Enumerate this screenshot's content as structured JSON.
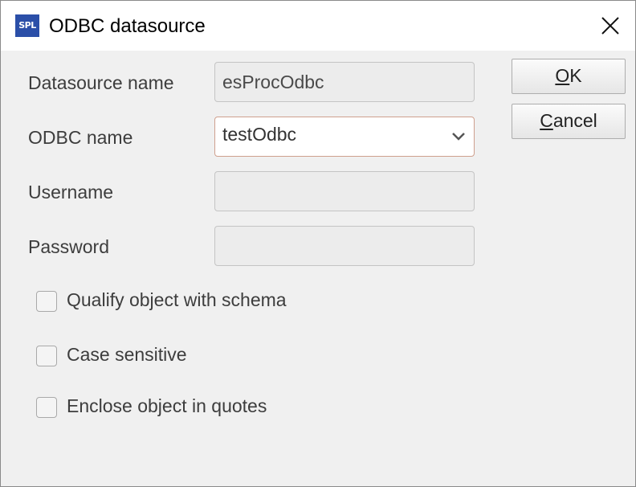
{
  "window": {
    "icon_text": "SPL",
    "title": "ODBC datasource",
    "close_icon": "close-icon"
  },
  "form": {
    "datasource_name": {
      "label": "Datasource name",
      "value": "esProcOdbc"
    },
    "odbc_name": {
      "label": "ODBC name",
      "value": "testOdbc",
      "icon": "chevron-down-icon"
    },
    "username": {
      "label": "Username",
      "value": ""
    },
    "password": {
      "label": "Password",
      "value": ""
    }
  },
  "options": {
    "qualify": {
      "label": "Qualify object with schema",
      "checked": false
    },
    "case_sensitive": {
      "label": "Case sensitive",
      "checked": false
    },
    "enclose": {
      "label": "Enclose object in quotes",
      "checked": false
    }
  },
  "buttons": {
    "ok": {
      "mnemonic": "O",
      "rest": "K"
    },
    "cancel": {
      "mnemonic": "C",
      "rest": "ancel"
    }
  },
  "colors": {
    "icon_bg": "#2b4fa8",
    "select_border": "#cfa08e",
    "dialog_bg": "#f0f0f0"
  }
}
